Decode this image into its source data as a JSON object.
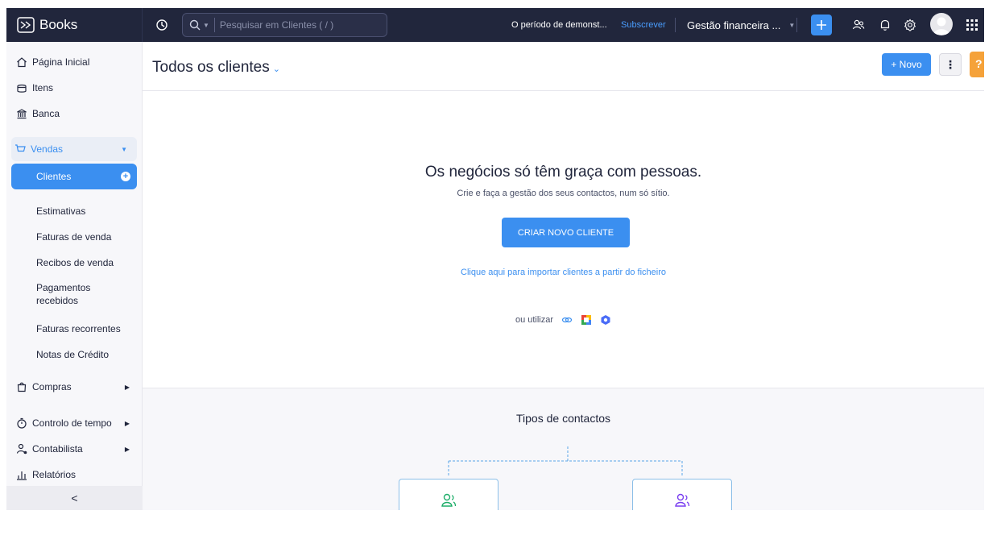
{
  "app": {
    "name": "Books"
  },
  "topbar": {
    "search_placeholder": "Pesquisar em Clientes ( / )",
    "trial_text": "O período de demonst...",
    "subscribe_label": "Subscrever",
    "org_name": "Gestão financeira ..."
  },
  "sidebar": {
    "items": [
      {
        "label": "Página Inicial"
      },
      {
        "label": "Itens"
      },
      {
        "label": "Banca"
      }
    ],
    "sales": {
      "label": "Vendas",
      "children": [
        {
          "label": "Clientes",
          "active": true
        },
        {
          "label": "Estimativas"
        },
        {
          "label": "Faturas de venda"
        },
        {
          "label": "Recibos de venda"
        },
        {
          "label": "Pagamentos recebidos"
        },
        {
          "label": "Faturas recorrentes"
        },
        {
          "label": "Notas de Crédito"
        }
      ]
    },
    "bottom_items": [
      {
        "label": "Compras"
      },
      {
        "label": "Controlo de tempo"
      },
      {
        "label": "Contabilista"
      },
      {
        "label": "Relatórios"
      }
    ],
    "collapse_glyph": "<"
  },
  "main": {
    "title": "Todos os clientes",
    "new_button": "+ Novo",
    "more_glyph": "⋮",
    "help_glyph": "?",
    "empty_title": "Os negócios só têm graça com pessoas.",
    "empty_subtitle": "Crie e faça a gestão dos seus contactos, num só sítio.",
    "create_button": "CRIAR NOVO CLIENTE",
    "import_link": "Clique aqui para importar clientes a partir do ficheiro",
    "alt_text": "ou utilizar",
    "contact_types_title": "Tipos de contactos"
  },
  "colors": {
    "topbar_bg": "#21263c",
    "accent": "#3b8ff0",
    "help": "#f5a23a"
  }
}
